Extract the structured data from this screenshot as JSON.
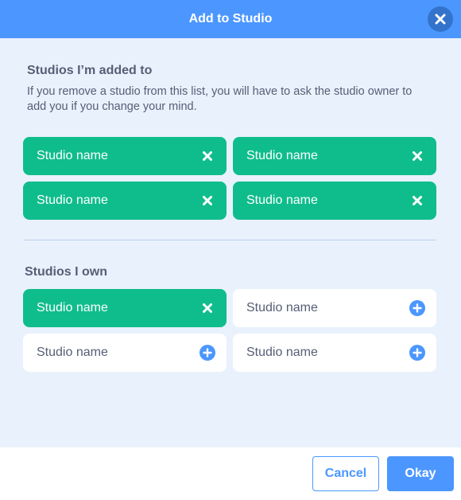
{
  "header": {
    "title": "Add to Studio"
  },
  "added_section": {
    "title": "Studios I’m added to",
    "description": "If you remove a studio from this list, you will have to ask the studio owner to add you if you change your mind.",
    "studios": [
      {
        "name": "Studio name",
        "state": "added",
        "icon": "remove-icon"
      },
      {
        "name": "Studio name",
        "state": "added",
        "icon": "remove-icon"
      },
      {
        "name": "Studio name",
        "state": "added",
        "icon": "remove-icon"
      },
      {
        "name": "Studio name",
        "state": "added",
        "icon": "remove-icon"
      }
    ]
  },
  "owned_section": {
    "title": "Studios I own",
    "studios": [
      {
        "name": "Studio name",
        "state": "added",
        "icon": "remove-icon"
      },
      {
        "name": "Studio name",
        "state": "not-added",
        "icon": "add-icon"
      },
      {
        "name": "Studio name",
        "state": "not-added",
        "icon": "add-icon"
      },
      {
        "name": "Studio name",
        "state": "not-added",
        "icon": "add-icon"
      }
    ]
  },
  "footer": {
    "cancel_label": "Cancel",
    "okay_label": "Okay"
  },
  "colors": {
    "header_blue": "#4c97ff",
    "close_button_bg": "#3373cc",
    "body_bg": "#e9f1fc",
    "added_green": "#0fbd8c",
    "text_gray": "#575e75",
    "divider": "#b9d3f2"
  }
}
